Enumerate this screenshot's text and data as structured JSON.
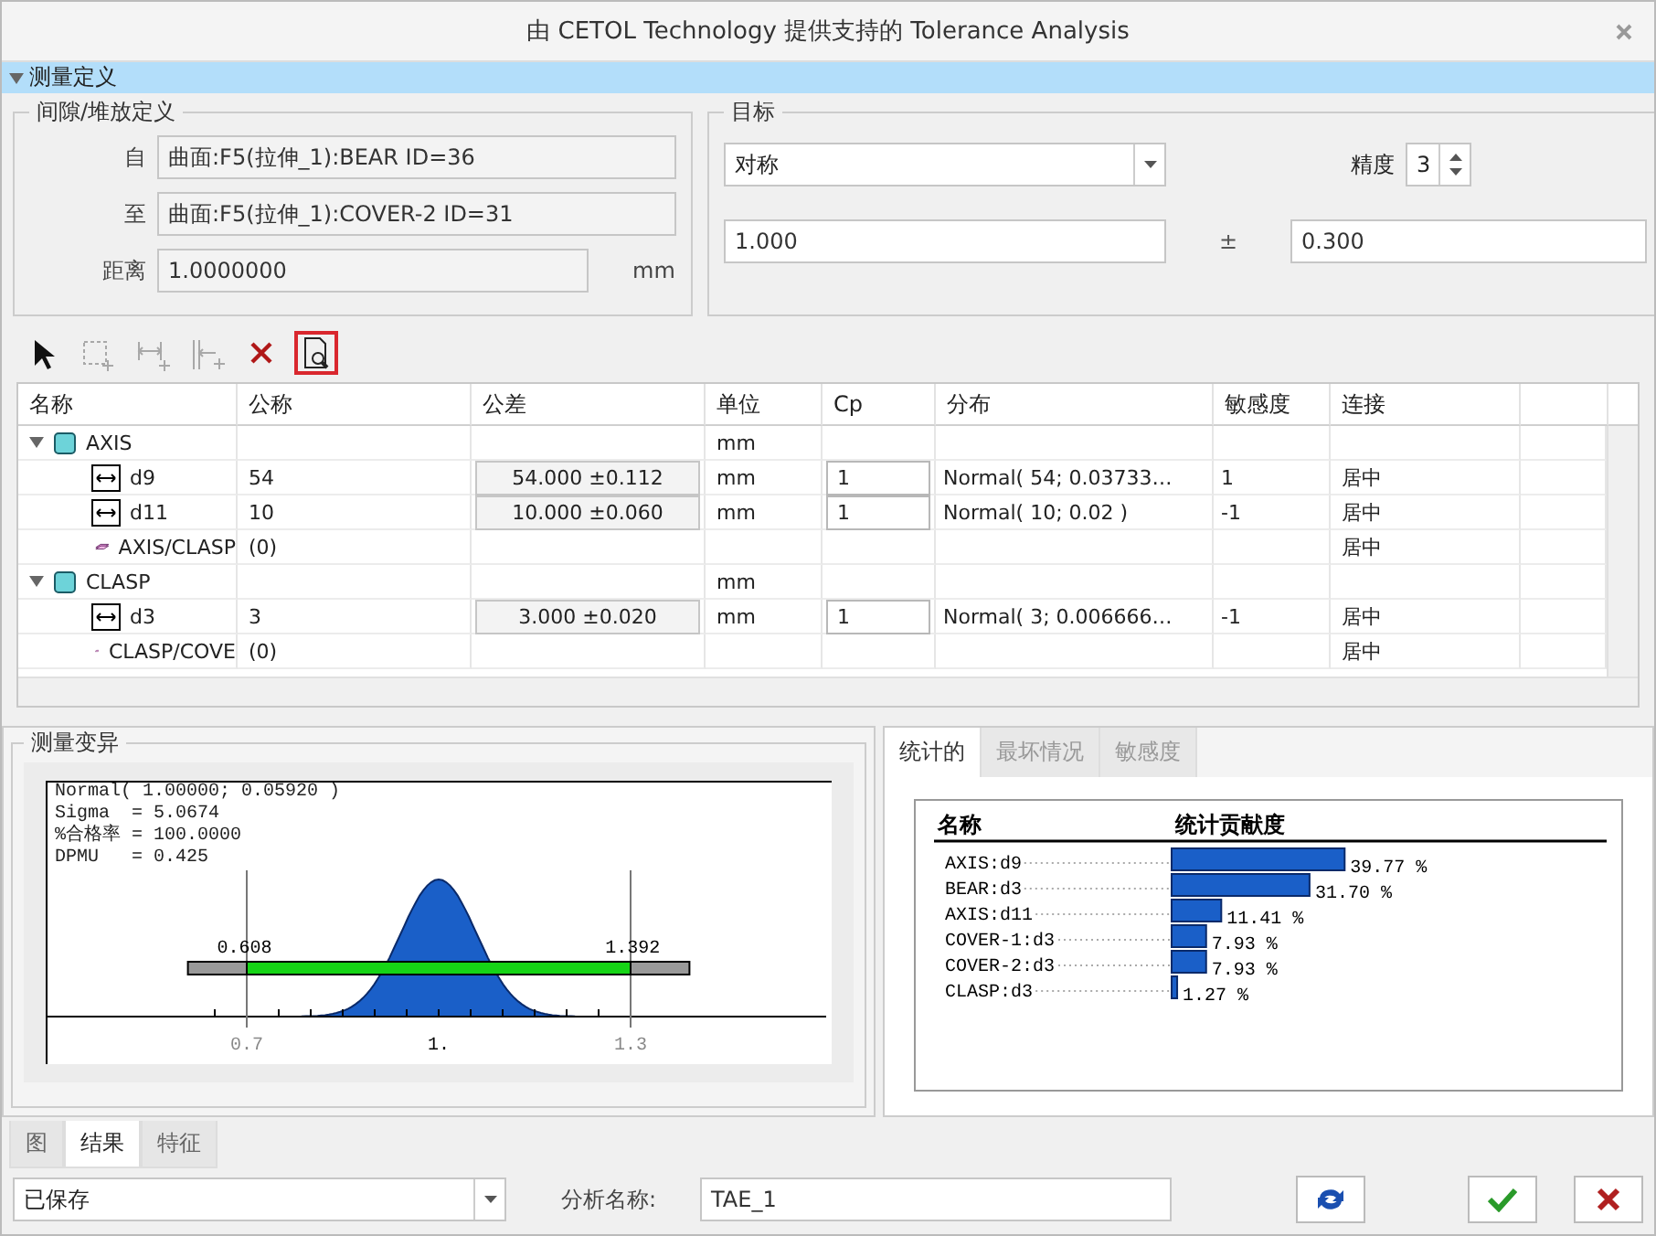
{
  "window": {
    "title": "由 CETOL Technology 提供支持的 Tolerance Analysis"
  },
  "section": {
    "title": "测量定义",
    "expanded": true
  },
  "gap_definition": {
    "title": "间隙/堆放定义",
    "fields": [
      {
        "label": "自",
        "value": "曲面:F5(拉伸_1):BEAR ID=36"
      },
      {
        "label": "至",
        "value": "曲面:F5(拉伸_1):COVER-2 ID=31"
      },
      {
        "label": "距离",
        "value": "1.0000000",
        "unit": "mm"
      }
    ]
  },
  "target": {
    "title": "目标",
    "type": "对称",
    "precision_label": "精度",
    "precision": "3",
    "nominal": "1.000",
    "plus_minus": "±",
    "tolerance": "0.300"
  },
  "toolbar": [
    {
      "disabled": false,
      "selected": false
    },
    {
      "disabled": true,
      "selected": false
    },
    {
      "disabled": true,
      "selected": false
    },
    {
      "disabled": true,
      "selected": false
    },
    {
      "disabled": false,
      "selected": false
    },
    {
      "disabled": false,
      "selected": true
    }
  ],
  "table": {
    "columns": [
      "名称",
      "公称",
      "公差",
      "单位",
      "Cp",
      "分布",
      "敏感度",
      "连接"
    ],
    "rows": [
      {
        "kind": "part",
        "name": "AXIS",
        "unit": "mm",
        "expanded": true,
        "children": [
          {
            "kind": "dimension",
            "name": "d9",
            "nominal": "54",
            "tolerance": "54.000 ±0.112",
            "unit": "mm",
            "cp": "1",
            "distribution": "Normal( 54; 0.03733…",
            "sensitivity": "1",
            "connection": "居中"
          },
          {
            "kind": "dimension",
            "name": "d11",
            "nominal": "10",
            "tolerance": "10.000 ±0.060",
            "unit": "mm",
            "cp": "1",
            "distribution": "Normal( 10; 0.02 )",
            "sensitivity": "-1",
            "connection": "居中"
          }
        ]
      },
      {
        "kind": "joint",
        "name": "AXIS/CLASP",
        "nominal": "(0)",
        "connection": "居中"
      },
      {
        "kind": "part",
        "name": "CLASP",
        "unit": "mm",
        "expanded": true,
        "children": [
          {
            "kind": "dimension",
            "name": "d3",
            "nominal": "3",
            "tolerance": "3.000 ±0.020",
            "unit": "mm",
            "cp": "1",
            "distribution": "Normal( 3; 0.006666…",
            "sensitivity": "-1",
            "connection": "居中"
          }
        ]
      },
      {
        "kind": "joint",
        "name": "CLASP/COVE",
        "nominal": "(0)",
        "connection": "居中"
      }
    ]
  },
  "variation": {
    "title": "测量变异",
    "stats": [
      "Normal( 1.00000; 0.05920 )",
      "Sigma  = 5.0674",
      "%合格率 = 100.0000",
      "DPMU   = 0.425"
    ],
    "lower_value": "0.608",
    "upper_value": "1.392",
    "axis_labels": [
      "0.7",
      "1.",
      "1.3"
    ]
  },
  "result_tabs": [
    {
      "label": "统计的",
      "selected": true
    },
    {
      "label": "最坏情况",
      "selected": false
    },
    {
      "label": "敏感度",
      "selected": false
    }
  ],
  "contribution": {
    "columns": [
      "名称",
      "统计贡献度"
    ],
    "chart_data": {
      "type": "bar",
      "orientation": "horizontal",
      "categories": [
        "AXIS:d9",
        "BEAR:d3",
        "AXIS:d11",
        "COVER-1:d3",
        "COVER-2:d3",
        "CLASP:d3"
      ],
      "values": [
        39.77,
        31.7,
        11.41,
        7.93,
        7.93,
        1.27
      ],
      "value_labels": [
        "39.77 %",
        "31.70 %",
        "11.41 %",
        "7.93 %",
        "7.93 %",
        "1.27 %"
      ]
    }
  },
  "bottom_tabs": [
    {
      "label": "图",
      "selected": false
    },
    {
      "label": "结果",
      "selected": true
    },
    {
      "label": "特征",
      "selected": false
    }
  ],
  "footer": {
    "status": "已保存",
    "name_label": "分析名称:",
    "name_value": "TAE_1"
  }
}
